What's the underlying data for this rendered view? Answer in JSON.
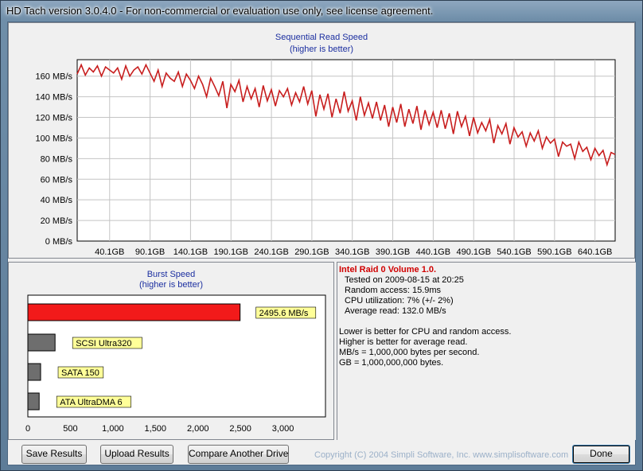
{
  "window": {
    "title": "HD Tach version 3.0.4.0  - For non-commercial or evaluation use only, see license agreement."
  },
  "colors": {
    "series": "#c81e1e",
    "burst_highlight": "#f21a1a",
    "burst_other": "#6e6e6e",
    "label_bg": "#ffff99",
    "chart_title": "#1c2fa0",
    "grid": "#c4c4c4"
  },
  "sequential_chart": {
    "title": "Sequential Read Speed",
    "subtitle": "(higher is better)",
    "y_tick_labels": [
      "0 MB/s",
      "20 MB/s",
      "40 MB/s",
      "60 MB/s",
      "80 MB/s",
      "100 MB/s",
      "120 MB/s",
      "140 MB/s",
      "160 MB/s"
    ],
    "x_tick_labels": [
      "40.1GB",
      "90.1GB",
      "140.1GB",
      "190.1GB",
      "240.1GB",
      "290.1GB",
      "340.1GB",
      "390.1GB",
      "440.1GB",
      "490.1GB",
      "540.1GB",
      "590.1GB",
      "640.1GB"
    ]
  },
  "burst_chart": {
    "title": "Burst Speed",
    "subtitle": "(higher is better)",
    "x_tick_labels": [
      "0",
      "500",
      "1,000",
      "1,500",
      "2,000",
      "2,500",
      "3,000"
    ]
  },
  "chart_data": [
    {
      "type": "line",
      "title": "Sequential Read Speed",
      "subtitle": "(higher is better)",
      "xlabel": "",
      "ylabel": "",
      "x_unit": "GB",
      "y_unit": "MB/s",
      "xlim": [
        0,
        665
      ],
      "ylim": [
        0,
        176
      ],
      "grid": true,
      "x_ticks": [
        40.1,
        90.1,
        140.1,
        190.1,
        240.1,
        290.1,
        340.1,
        390.1,
        440.1,
        490.1,
        540.1,
        590.1,
        640.1
      ],
      "y_ticks": [
        0,
        20,
        40,
        60,
        80,
        100,
        120,
        140,
        160
      ],
      "series": [
        {
          "x": [
            0,
            5,
            10,
            15,
            20,
            25,
            30,
            35,
            40,
            45,
            50,
            55,
            60,
            65,
            70,
            75,
            80,
            85,
            90,
            95,
            100,
            105,
            110,
            115,
            120,
            125,
            130,
            135,
            140,
            145,
            150,
            155,
            160,
            165,
            170,
            175,
            180,
            185,
            190,
            195,
            200,
            205,
            210,
            215,
            220,
            225,
            230,
            235,
            240,
            245,
            250,
            255,
            260,
            265,
            270,
            275,
            280,
            285,
            290,
            295,
            300,
            305,
            310,
            315,
            320,
            325,
            330,
            335,
            340,
            345,
            350,
            355,
            360,
            365,
            370,
            375,
            380,
            385,
            390,
            395,
            400,
            405,
            410,
            415,
            420,
            425,
            430,
            435,
            440,
            445,
            450,
            455,
            460,
            465,
            470,
            475,
            480,
            485,
            490,
            495,
            500,
            505,
            510,
            515,
            520,
            525,
            530,
            535,
            540,
            545,
            550,
            555,
            560,
            565,
            570,
            575,
            580,
            585,
            590,
            595,
            600,
            605,
            610,
            615,
            620,
            625,
            630,
            635,
            640,
            645,
            650,
            655,
            660,
            665
          ],
          "y": [
            162,
            171,
            161,
            168,
            164,
            170,
            160,
            169,
            166,
            163,
            168,
            157,
            170,
            160,
            166,
            169,
            162,
            171,
            163,
            155,
            166,
            150,
            163,
            158,
            155,
            164,
            150,
            162,
            156,
            148,
            160,
            152,
            140,
            158,
            150,
            141,
            155,
            129,
            152,
            145,
            156,
            135,
            150,
            138,
            148,
            130,
            151,
            136,
            147,
            131,
            146,
            140,
            148,
            132,
            144,
            135,
            150,
            133,
            146,
            121,
            142,
            128,
            143,
            120,
            138,
            124,
            145,
            126,
            136,
            117,
            140,
            122,
            134,
            119,
            135,
            117,
            132,
            111,
            130,
            115,
            133,
            111,
            128,
            114,
            131,
            108,
            127,
            113,
            125,
            110,
            127,
            109,
            124,
            104,
            126,
            111,
            121,
            102,
            120,
            105,
            115,
            107,
            118,
            95,
            112,
            104,
            114,
            94,
            110,
            101,
            106,
            92,
            105,
            97,
            107,
            90,
            101,
            95,
            99,
            82,
            96,
            92,
            94,
            80,
            96,
            87,
            91,
            79,
            90,
            83,
            88,
            74,
            86,
            84
          ]
        }
      ]
    },
    {
      "type": "bar",
      "orientation": "horizontal",
      "title": "Burst Speed",
      "subtitle": "(higher is better)",
      "xlabel": "",
      "ylabel": "",
      "xlim": [
        0,
        3500
      ],
      "grid": false,
      "x_ticks": [
        0,
        500,
        1000,
        1500,
        2000,
        2500,
        3000
      ],
      "categories": [
        "2495.6 MB/s",
        "SCSI Ultra320",
        "SATA 150",
        "ATA UltraDMA 6"
      ],
      "values": [
        2495.6,
        320,
        150,
        133
      ]
    }
  ],
  "info": {
    "drive_name": "Intel Raid 0 Volume 1.0.",
    "tested_on": "Tested on 2009-08-15 at 20:25",
    "random_access": "Random access: 15.9ms",
    "cpu_utilization": "CPU utilization: 7% (+/- 2%)",
    "average_read": "Average read: 132.0 MB/s",
    "note1": "Lower is better for CPU and random access.",
    "note2": "Higher is better for average read.",
    "note3": "MB/s = 1,000,000 bytes per second.",
    "note4": "GB = 1,000,000,000 bytes."
  },
  "buttons": {
    "save": "Save Results",
    "upload": "Upload Results",
    "compare": "Compare Another Drive",
    "done": "Done"
  },
  "copyright": "Copyright (C) 2004 Simpli Software, Inc. www.simplisoftware.com"
}
